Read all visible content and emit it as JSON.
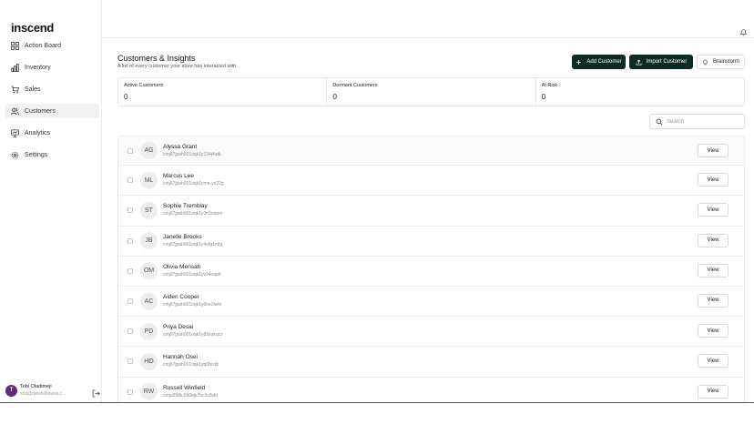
{
  "brand": {
    "logo": "inscend"
  },
  "sidebar": {
    "items": [
      {
        "label": "Action Board",
        "icon": "grid-icon",
        "active": false
      },
      {
        "label": "Inventory",
        "icon": "bar-chart-icon",
        "active": false
      },
      {
        "label": "Sales",
        "icon": "cart-icon",
        "active": false
      },
      {
        "label": "Customers",
        "icon": "users-icon",
        "active": true
      },
      {
        "label": "Analytics",
        "icon": "presentation-icon",
        "active": false
      },
      {
        "label": "Settings",
        "icon": "gear-icon",
        "active": false
      }
    ],
    "user": {
      "initial": "T",
      "name": "Tobi Oladimeji",
      "email": "tobi@datafellowsai.c..."
    }
  },
  "header": {
    "title": "Customers & Insights",
    "subtitle": "A list of every customer your store has interacted with.",
    "add_label": "Add Customer",
    "import_label": "Import Customer",
    "brainstorm_label": "Brainstorm"
  },
  "stats": [
    {
      "label": "Active Customers",
      "value": "0"
    },
    {
      "label": "Dormant Customers",
      "value": "0"
    },
    {
      "label": "At Risk",
      "value": "0"
    }
  ],
  "search": {
    "placeholder": "Search"
  },
  "customers": [
    {
      "initials": "AG",
      "name": "Alyssa Grant",
      "id": "cmj97jpah001oqk1y134j4atb",
      "action": "View"
    },
    {
      "initials": "ML",
      "name": "Marcus Lee",
      "id": "cmj97jpah001oqk1ymn-yo22g",
      "action": "View"
    },
    {
      "initials": "ST",
      "name": "Sophie Tremblay",
      "id": "cmj97jpah001oqk1y3n3oopm",
      "action": "View"
    },
    {
      "initials": "JB",
      "name": "Janelle Brooks",
      "id": "cmj97jpah001oqk1y4efg1mtg",
      "action": "View"
    },
    {
      "initials": "OM",
      "name": "Olivia Mensah",
      "id": "cmj97jpah001oqk1yv94oapit",
      "action": "View"
    },
    {
      "initials": "AC",
      "name": "Aiden Cooper",
      "id": "cmj97jpah001oqk1y6he2iwlo",
      "action": "View"
    },
    {
      "initials": "PD",
      "name": "Priya Desai",
      "id": "cmj97jpah001oqk1y89xqkqcz",
      "action": "View"
    },
    {
      "initials": "HO",
      "name": "Hannah Osei",
      "id": "cmj97jpah001oqk1yq6fexjlz",
      "action": "View"
    },
    {
      "initials": "RW",
      "name": "Russell Winfield",
      "id": "cmju058tc000iqk7bc3c8xkr",
      "action": "View"
    }
  ]
}
